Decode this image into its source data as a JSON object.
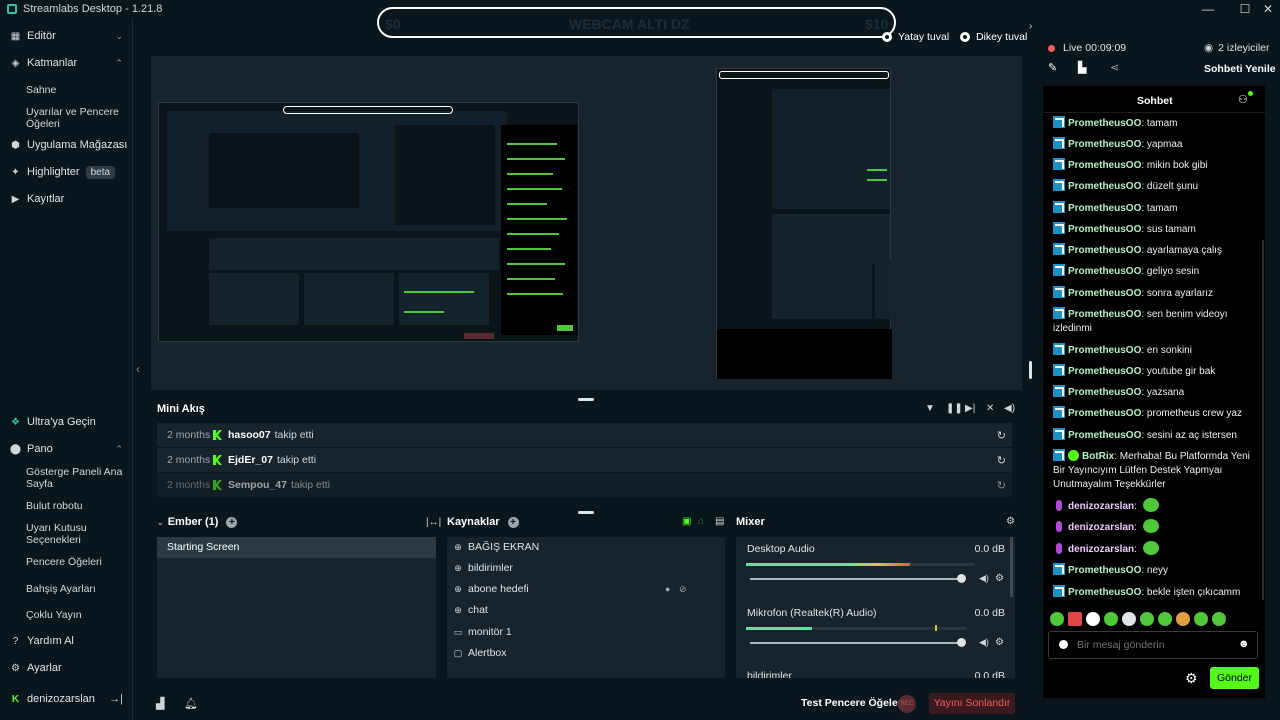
{
  "app": {
    "title": "Streamlabs Desktop - 1.21.8"
  },
  "window": {
    "min": "—",
    "max": "☐",
    "close": "✕"
  },
  "sidebar": {
    "items": [
      {
        "label": "Editör",
        "icon": "editor-icon"
      },
      {
        "label": "Katmanlar",
        "icon": "layers-icon"
      },
      {
        "label": "Uygulama Mağazası",
        "icon": "app-store-icon"
      },
      {
        "label": "Highlighter",
        "icon": "highlighter-icon",
        "badge": "beta"
      },
      {
        "label": "Kayıtlar",
        "icon": "recordings-icon"
      }
    ],
    "layers_sub": [
      "Sahne",
      "Uyarılar ve Pencere Öğeleri"
    ],
    "bottom_items": [
      {
        "label": "Ultra'ya Geçin",
        "icon": "ultra-icon"
      },
      {
        "label": "Pano",
        "icon": "dashboard-icon"
      }
    ],
    "pano_sub": [
      "Gösterge Paneli Ana Sayfa",
      "Bulut robotu",
      "Uyarı Kutusu Seçenekleri",
      "Pencere Öğeleri",
      "Bahşiş Ayarları",
      "Çoklu Yayın"
    ],
    "footer_items": [
      {
        "label": "Yardım Al",
        "icon": "help-icon"
      },
      {
        "label": "Ayarlar",
        "icon": "settings-icon"
      }
    ],
    "user": "denizozarslan"
  },
  "overlay_text": {
    "left": "$0",
    "center": "WEBCAM ALTI DZ",
    "right": "$10"
  },
  "view_toggles": {
    "horizontal": "Yatay tuval",
    "vertical": "Dikey tuval"
  },
  "mini_feed": {
    "title": "Mini Akış",
    "rows": [
      {
        "time": "2 months",
        "user": "hasoo07",
        "action": "takip etti"
      },
      {
        "time": "2 months",
        "user": "EjdEr_07",
        "action": "takip etti"
      },
      {
        "time": "2 months",
        "user": "Sempou_47",
        "action": "takip etti"
      }
    ]
  },
  "scenes": {
    "title": "Ember (1)",
    "items": [
      "Starting Screen"
    ]
  },
  "sources": {
    "title": "Kaynaklar",
    "items": [
      {
        "label": "BAĞIŞ EKRAN",
        "icon": "globe-icon"
      },
      {
        "label": "bildirimler",
        "icon": "globe-icon"
      },
      {
        "label": "abone hedefi",
        "icon": "globe-icon"
      },
      {
        "label": "chat",
        "icon": "globe-icon"
      },
      {
        "label": "monitör 1",
        "icon": "monitor-icon"
      },
      {
        "label": "Alertbox",
        "icon": "alertbox-icon"
      }
    ]
  },
  "mixer": {
    "title": "Mixer",
    "channels": [
      {
        "name": "Desktop Audio",
        "db": "0.0 dB",
        "level": 0.72
      },
      {
        "name": "Mikrofon (Realtek(R) Audio)",
        "db": "0.0 dB",
        "level": 0.3
      },
      {
        "name": "bildirimler",
        "db": "0.0 dB",
        "level": 0
      }
    ]
  },
  "bottom": {
    "test_widgets": "Test Pencere Öğeleri",
    "rec": "REC",
    "end_stream": "Yayını Sonlandır"
  },
  "live": {
    "status": "Live",
    "time": "00:09:09",
    "viewers": "2 izleyiciler",
    "refresh": "Sohbeti Yenile"
  },
  "chat": {
    "title": "Sohbet",
    "messages": [
      {
        "user": "PrometheusOO",
        "text": "tamam",
        "type": "kick"
      },
      {
        "user": "PrometheusOO",
        "text": "yapmaa",
        "type": "kick"
      },
      {
        "user": "PrometheusOO",
        "text": "mikin bok gibi",
        "type": "kick"
      },
      {
        "user": "PrometheusOO",
        "text": "düzelt şunu",
        "type": "kick"
      },
      {
        "user": "PrometheusOO",
        "text": "tamam",
        "type": "kick"
      },
      {
        "user": "PrometheusOO",
        "text": "sus tamam",
        "type": "kick"
      },
      {
        "user": "PrometheusOO",
        "text": "ayarlamaya çalış",
        "type": "kick"
      },
      {
        "user": "PrometheusOO",
        "text": "geliyo sesin",
        "type": "kick"
      },
      {
        "user": "PrometheusOO",
        "text": "sonra ayarlarız",
        "type": "kick"
      },
      {
        "user": "PrometheusOO",
        "text": "sen benim videoyı izledinmi",
        "type": "kick"
      },
      {
        "user": "PrometheusOO",
        "text": "en sonkini",
        "type": "kick"
      },
      {
        "user": "PrometheusOO",
        "text": "youtube gir bak",
        "type": "kick"
      },
      {
        "user": "PrometheusOO",
        "text": "yazsana",
        "type": "kick"
      },
      {
        "user": "PrometheusOO",
        "text": "prometheus crew yaz",
        "type": "kick"
      },
      {
        "user": "PrometheusOO",
        "text": "sesini az aç istersen",
        "type": "kick"
      },
      {
        "user": "BotRix",
        "text": "Merhaba! Bu Platformda Yeni Bir Yayıncıyım Lütfen Destek Yapmyaı Unutmayalım Teşekkürler",
        "type": "bot"
      },
      {
        "user": "denizozarslan",
        "text": "",
        "type": "mic"
      },
      {
        "user": "denizozarslan",
        "text": "",
        "type": "mic"
      },
      {
        "user": "denizozarslan",
        "text": "",
        "type": "mic"
      },
      {
        "user": "PrometheusOO",
        "text": "neyy",
        "type": "kick"
      },
      {
        "user": "PrometheusOO",
        "text": "bekle işten çıkıcamm",
        "type": "kick"
      }
    ],
    "placeholder": "Bir mesaj gönderin",
    "send": "Gönder"
  },
  "colors": {
    "accent": "#53fc18",
    "bg": "#09161d",
    "panel": "#17242d",
    "end": "#f25d5d"
  }
}
